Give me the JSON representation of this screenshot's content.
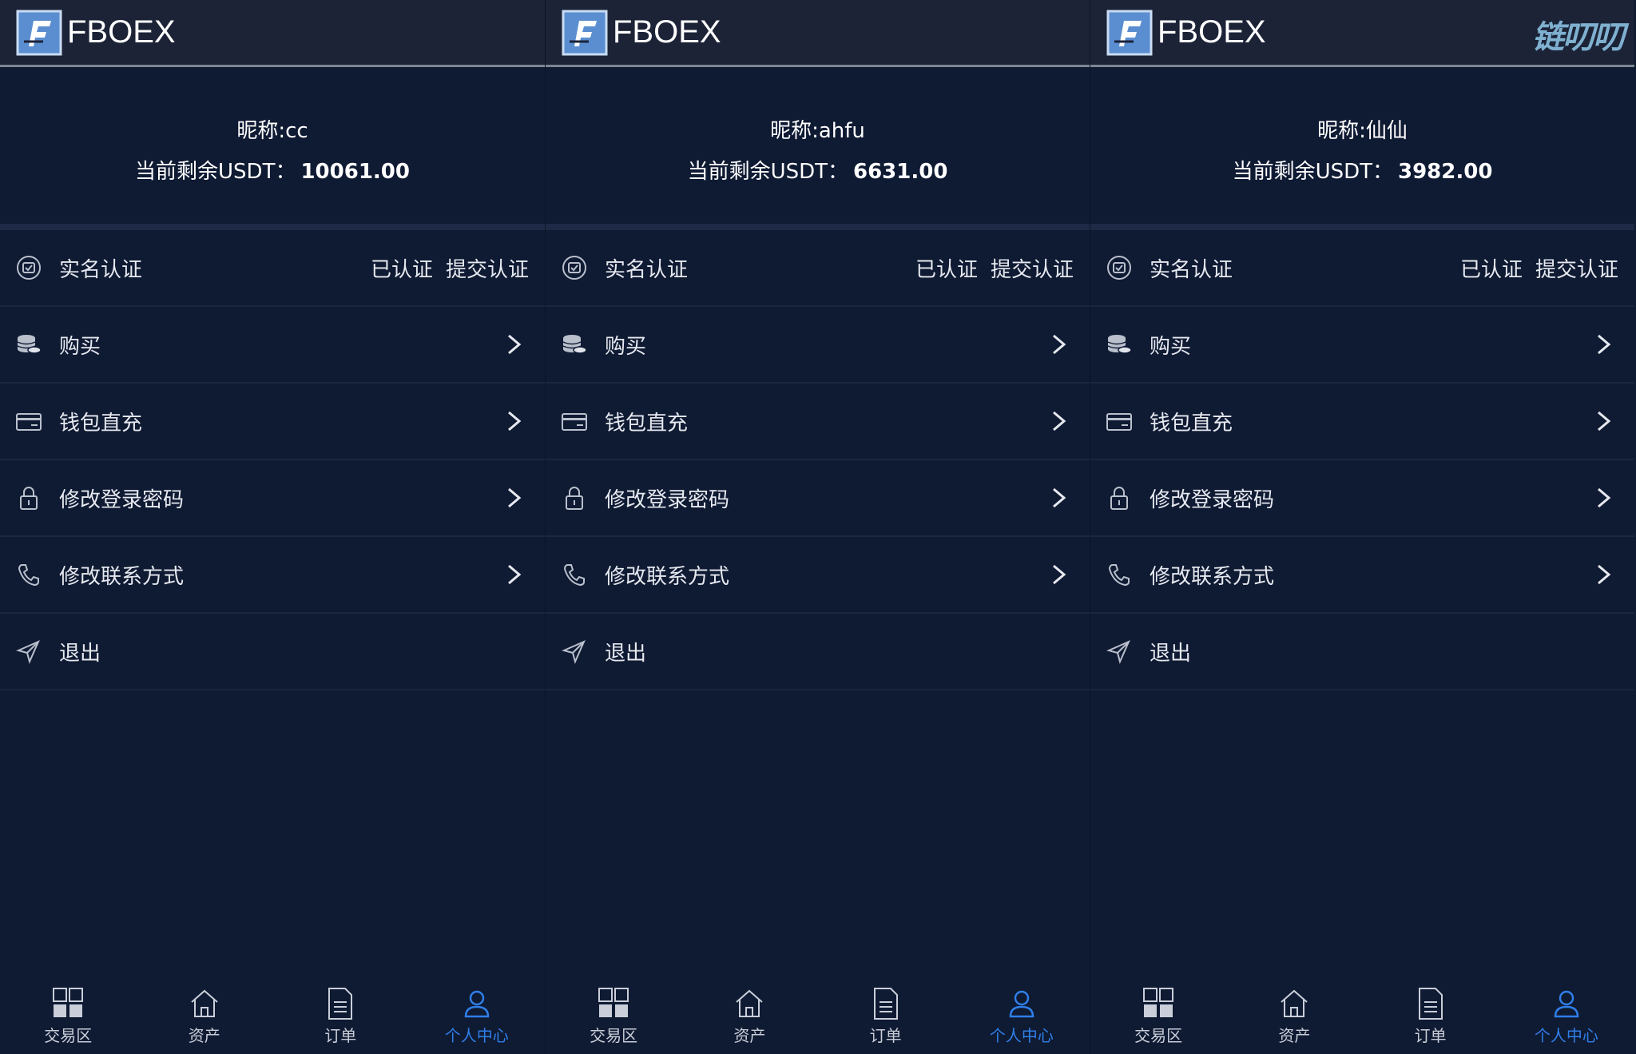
{
  "watermark": "链叨叨",
  "colors": {
    "background": "#0f1a33",
    "header": "#1c2337",
    "accent": "#2f7fe8"
  },
  "panels": [
    {
      "brand": "FBOEX",
      "nickname": "昵称:cc",
      "balance_label": "当前剩余USDT：",
      "balance_value": "10061.00",
      "menu": {
        "verify": {
          "label": "实名认证",
          "status": "已认证",
          "action": "提交认证"
        },
        "buy": "购买",
        "wallet": "钱包直充",
        "password": "修改登录密码",
        "contact": "修改联系方式",
        "logout": "退出"
      },
      "tabs": {
        "trade": "交易区",
        "assets": "资产",
        "orders": "订单",
        "profile": "个人中心"
      }
    },
    {
      "brand": "FBOEX",
      "nickname": "昵称:ahfu",
      "balance_label": "当前剩余USDT：",
      "balance_value": "6631.00",
      "menu": {
        "verify": {
          "label": "实名认证",
          "status": "已认证",
          "action": "提交认证"
        },
        "buy": "购买",
        "wallet": "钱包直充",
        "password": "修改登录密码",
        "contact": "修改联系方式",
        "logout": "退出"
      },
      "tabs": {
        "trade": "交易区",
        "assets": "资产",
        "orders": "订单",
        "profile": "个人中心"
      }
    },
    {
      "brand": "FBOEX",
      "nickname": "昵称:仙仙",
      "balance_label": "当前剩余USDT：",
      "balance_value": "3982.00",
      "menu": {
        "verify": {
          "label": "实名认证",
          "status": "已认证",
          "action": "提交认证"
        },
        "buy": "购买",
        "wallet": "钱包直充",
        "password": "修改登录密码",
        "contact": "修改联系方式",
        "logout": "退出"
      },
      "tabs": {
        "trade": "交易区",
        "assets": "资产",
        "orders": "订单",
        "profile": "个人中心"
      }
    }
  ]
}
